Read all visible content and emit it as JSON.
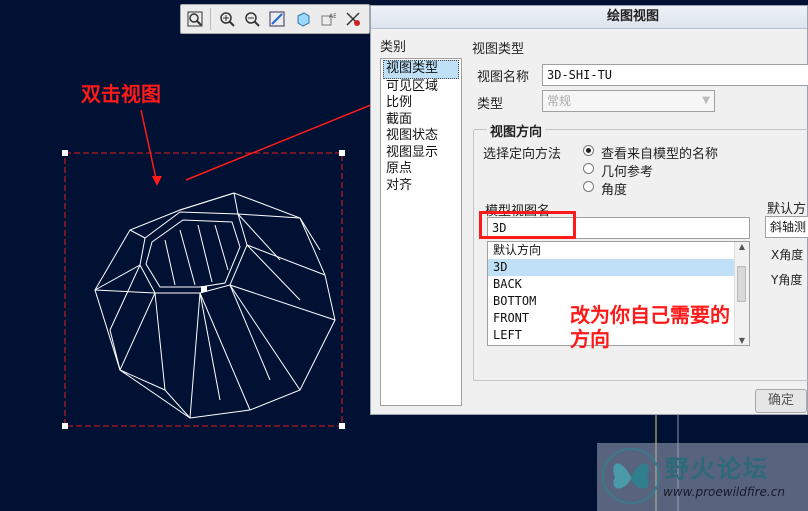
{
  "annotations": {
    "double_click": "双击视图",
    "change_direction_line1": "改为你自己需要的",
    "change_direction_line2": "方向"
  },
  "dialog": {
    "title": "绘图视图",
    "category_label": "类别",
    "categories": [
      "视图类型",
      "可见区域",
      "比例",
      "截面",
      "视图状态",
      "视图显示",
      "原点",
      "对齐"
    ],
    "section_title": "视图类型",
    "view_name_label": "视图名称",
    "view_name_value": "3D-SHI-TU",
    "type_label": "类型",
    "type_value": "常规",
    "orientation_group": "视图方向",
    "orientation_method_label": "选择定向方法",
    "orientation_options": [
      "查看来自模型的名称",
      "几何参考",
      "角度"
    ],
    "model_view_name_label": "模型视图名",
    "model_view_name_value": "3D",
    "model_views": [
      "默认方向",
      "3D",
      "BACK",
      "BOTTOM",
      "FRONT",
      "LEFT"
    ],
    "default_orientation_label": "默认方",
    "default_orientation_value": "斜轴测",
    "x_angle_label": "X角度",
    "y_angle_label": "Y角度",
    "ok_button": "确定"
  },
  "watermark": {
    "site_name": "野火论坛",
    "url": "www.proewildfire.cn"
  },
  "colors": {
    "background": "#001133",
    "annotation_red": "#ff1a1a",
    "selection": "#bfe0f7"
  }
}
